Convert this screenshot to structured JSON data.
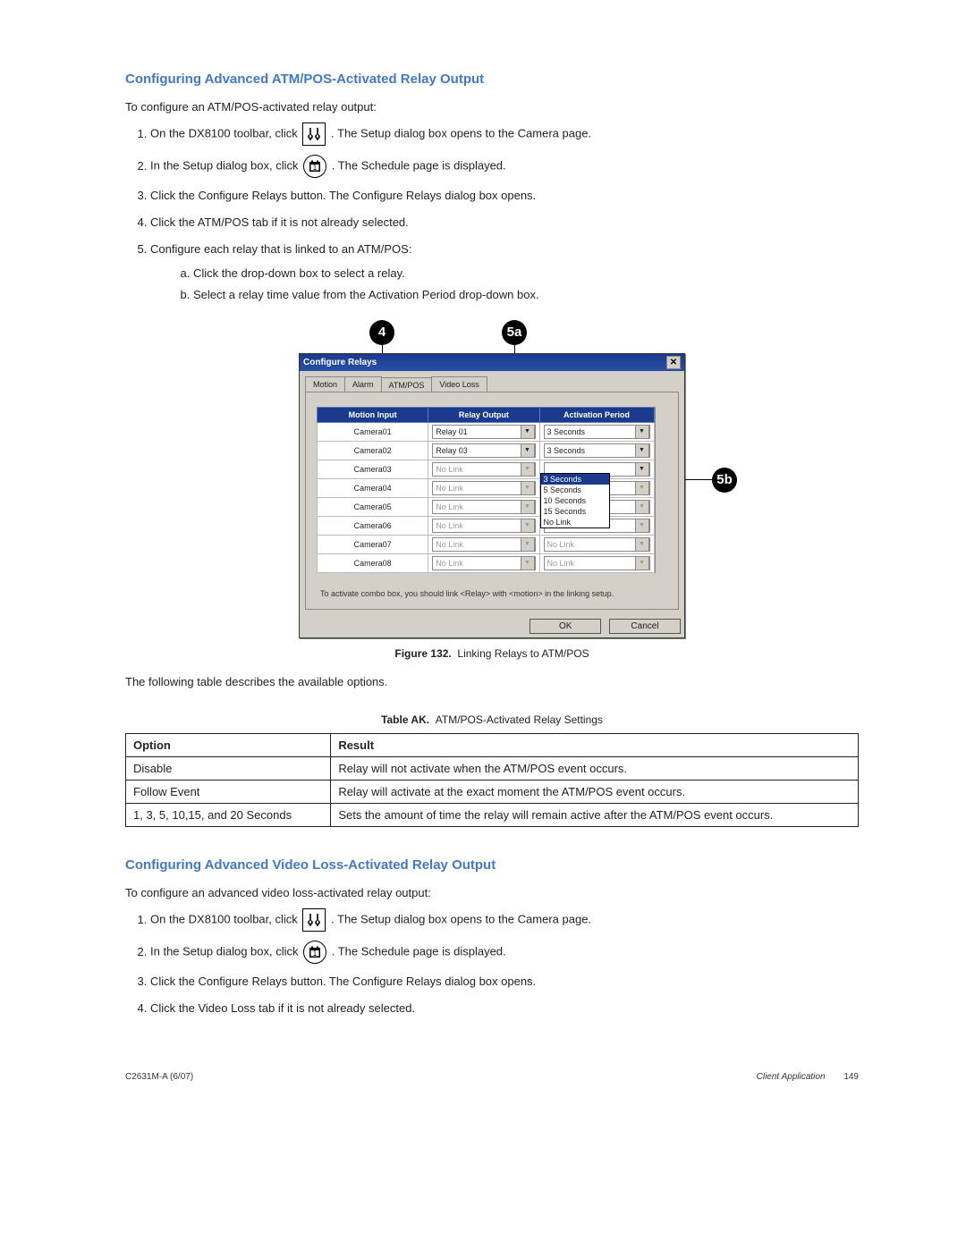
{
  "section1": {
    "heading": "Configuring Advanced ATM/POS-Activated Relay Output",
    "intro": "To configure an ATM/POS-activated relay output:",
    "steps": {
      "s1a": "On the DX8100 toolbar, click",
      "s1b": ". The Setup dialog box opens to the Camera page.",
      "s2a": "In the Setup dialog box, click",
      "s2b": ". The Schedule page is displayed.",
      "s3": "Click the Configure Relays button. The Configure Relays dialog box opens.",
      "s4": "Click the ATM/POS tab if it is not already selected.",
      "s5": "Configure each relay that is linked to an ATM/POS:",
      "s5a": "Click the drop-down box to select a relay.",
      "s5b": "Select a relay time value from the Activation Period drop-down box."
    }
  },
  "callouts": {
    "c4": "4",
    "c5a": "5a",
    "c5b": "5b"
  },
  "dialog": {
    "title": "Configure Relays",
    "tabs": [
      "Motion",
      "Alarm",
      "ATM/POS",
      "Video Loss"
    ],
    "headers": {
      "h1": "Motion Input",
      "h2": "Relay Output",
      "h3": "Activation Period"
    },
    "rows": [
      {
        "input": "Camera01",
        "relay": "Relay 01",
        "period": "3 Seconds"
      },
      {
        "input": "Camera02",
        "relay": "Relay 03",
        "period": "3 Seconds"
      },
      {
        "input": "Camera03",
        "relay": "No Link",
        "period": ""
      },
      {
        "input": "Camera04",
        "relay": "No Link",
        "period": ""
      },
      {
        "input": "Camera05",
        "relay": "No Link",
        "period": ""
      },
      {
        "input": "Camera06",
        "relay": "No Link",
        "period": "No Link"
      },
      {
        "input": "Camera07",
        "relay": "No Link",
        "period": "No Link"
      },
      {
        "input": "Camera08",
        "relay": "No Link",
        "period": "No Link"
      }
    ],
    "dropdown_options": [
      "3 Seconds",
      "5 Seconds",
      "10 Seconds",
      "15 Seconds",
      "No Link"
    ],
    "hint": "To activate combo box, you should link <Relay> with <motion> in the linking setup.",
    "ok": "OK",
    "cancel": "Cancel"
  },
  "figure": {
    "label": "Figure 132.",
    "text": "Linking Relays to ATM/POS"
  },
  "after_figure": "The following table describes the available options.",
  "tableAK": {
    "label": "Table AK.",
    "text": "ATM/POS-Activated Relay Settings",
    "head": {
      "c1": "Option",
      "c2": "Result"
    },
    "rows": [
      {
        "opt": "Disable",
        "res": "Relay will not activate when the ATM/POS event occurs."
      },
      {
        "opt": "Follow Event",
        "res": "Relay will activate at the exact moment the ATM/POS event occurs."
      },
      {
        "opt": "1, 3, 5, 10,15, and 20 Seconds",
        "res": "Sets the amount of time the relay will remain active after the ATM/POS event occurs."
      }
    ]
  },
  "section2": {
    "heading": "Configuring Advanced Video Loss-Activated Relay Output",
    "intro": "To configure an advanced video loss-activated relay output:",
    "steps": {
      "s1a": "On the DX8100 toolbar, click",
      "s1b": ". The Setup dialog box opens to the Camera page.",
      "s2a": "In the Setup dialog box, click",
      "s2b": ". The Schedule page is displayed.",
      "s3": "Click the Configure Relays button. The Configure Relays dialog box opens.",
      "s4": "Click the Video Loss tab if it is not already selected."
    }
  },
  "footer": {
    "left": "C2631M-A (6/07)",
    "right_label": "Client Application",
    "page": "149"
  }
}
